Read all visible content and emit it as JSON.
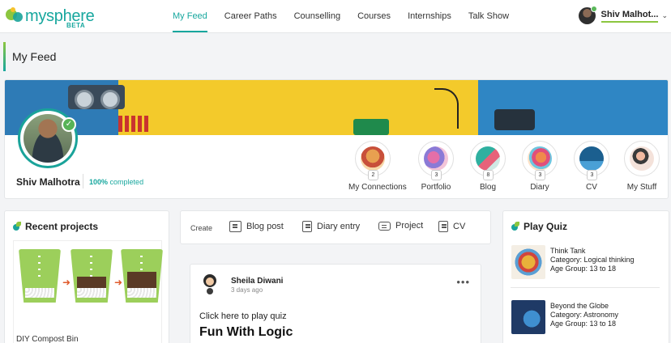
{
  "brand": {
    "name": "mysphere",
    "tag": "BETA"
  },
  "nav": {
    "items": [
      "My Feed",
      "Career Paths",
      "Counselling",
      "Courses",
      "Internships",
      "Talk Show"
    ],
    "active": "My Feed"
  },
  "user": {
    "name": "Shiv Malhot...",
    "caret": "⌄"
  },
  "page": {
    "title": "My Feed"
  },
  "profile": {
    "name": "Shiv Malhotra",
    "complete_value": "100%",
    "complete_text": "completed",
    "badge": "✓",
    "quick_links": [
      {
        "label": "My Connections",
        "count": "2",
        "icon": "people-icon"
      },
      {
        "label": "Portfolio",
        "count": "3",
        "icon": "portfolio-icon"
      },
      {
        "label": "Blog",
        "count": "8",
        "icon": "blog-icon"
      },
      {
        "label": "Diary",
        "count": "3",
        "icon": "diary-icon"
      },
      {
        "label": "CV",
        "count": "3",
        "icon": "cv-icon"
      },
      {
        "label": "My Stuff",
        "count": "",
        "icon": "stuff-icon"
      }
    ]
  },
  "recent_projects": {
    "title": "Recent projects",
    "items": [
      {
        "label": "DIY Compost Bin"
      }
    ]
  },
  "create": {
    "label": "Create",
    "items": [
      {
        "label": "Blog post",
        "icon": "blog-post-icon"
      },
      {
        "label": "Diary entry",
        "icon": "diary-entry-icon"
      },
      {
        "label": "Project",
        "icon": "project-icon"
      },
      {
        "label": "CV",
        "icon": "cv-doc-icon"
      }
    ]
  },
  "feed": {
    "post": {
      "author": "Sheila Diwani",
      "time": "3 days ago",
      "cta": "Click here to play quiz",
      "title": "Fun With Logic",
      "more": "•••"
    }
  },
  "play_quiz": {
    "title": "Play Quiz",
    "items": [
      {
        "name": "Think Tank",
        "category": "Category: Logical thinking",
        "age": "Age Group: 13 to 18"
      },
      {
        "name": "Beyond the Globe",
        "category": "Category: Astronomy",
        "age": "Age Group: 13 to 18"
      }
    ]
  },
  "colors": {
    "accent": "#17a79e",
    "green": "#8cc63f",
    "banner_yellow": "#f3ca2b",
    "banner_blue": "#2f86c4"
  }
}
